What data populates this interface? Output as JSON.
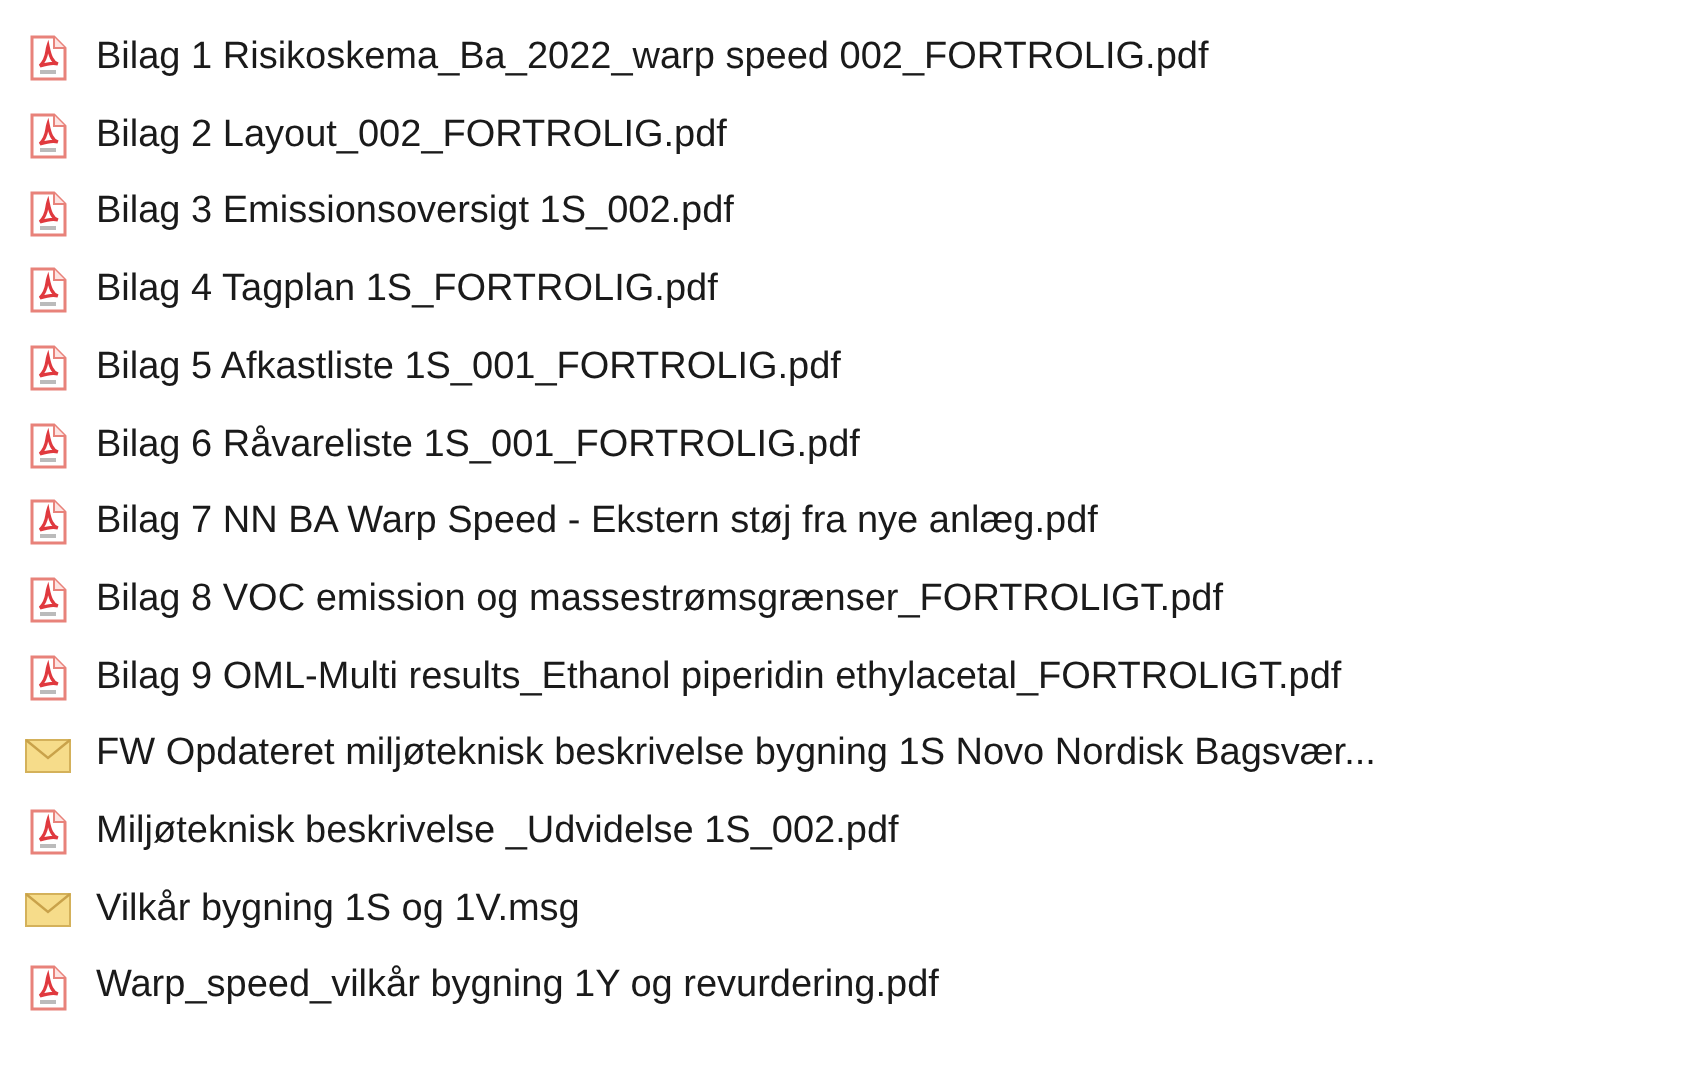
{
  "files": [
    {
      "kind": "pdf",
      "name": "Bilag 1 Risikoskema_Ba_2022_warp speed 002_FORTROLIG.pdf"
    },
    {
      "kind": "pdf",
      "name": "Bilag 2 Layout_002_FORTROLIG.pdf"
    },
    {
      "kind": "pdf",
      "name": "Bilag 3 Emissionsoversigt 1S_002.pdf"
    },
    {
      "kind": "pdf",
      "name": "Bilag 4 Tagplan 1S_FORTROLIG.pdf"
    },
    {
      "kind": "pdf",
      "name": "Bilag 5 Afkastliste 1S_001_FORTROLIG.pdf"
    },
    {
      "kind": "pdf",
      "name": "Bilag 6 Råvareliste 1S_001_FORTROLIG.pdf"
    },
    {
      "kind": "pdf",
      "name": "Bilag 7 NN BA Warp Speed - Ekstern støj fra nye anlæg.pdf"
    },
    {
      "kind": "pdf",
      "name": "Bilag 8 VOC emission og massestrømsgrænser_FORTROLIGT.pdf"
    },
    {
      "kind": "pdf",
      "name": "Bilag 9 OML-Multi results_Ethanol piperidin ethylacetal_FORTROLIGT.pdf"
    },
    {
      "kind": "mail",
      "name": "FW Opdateret miljøteknisk beskrivelse bygning 1S Novo Nordisk Bagsvær..."
    },
    {
      "kind": "pdf",
      "name": "Miljøteknisk beskrivelse _Udvidelse 1S_002.pdf"
    },
    {
      "kind": "mail",
      "name": "Vilkår bygning 1S og 1V.msg"
    },
    {
      "kind": "pdf",
      "name": "Warp_speed_vilkår bygning 1Y og revurdering.pdf"
    }
  ]
}
